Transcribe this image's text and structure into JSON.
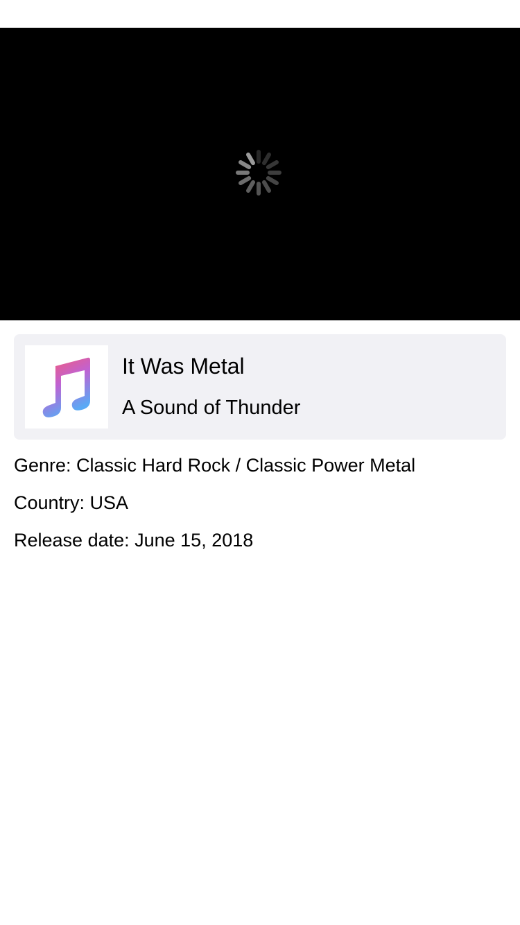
{
  "player": {
    "state": "loading",
    "spinner_icon": "activity-spinner-icon"
  },
  "track": {
    "title": "It Was Metal",
    "artist": "A Sound of Thunder",
    "artwork_icon": "apple-music-note-icon"
  },
  "details": {
    "genre": "Genre: Classic Hard Rock / Classic Power Metal",
    "country": "Country: USA",
    "release_date": "Release date: June 15, 2018"
  },
  "colors": {
    "player_background": "#000000",
    "card_background": "#f1f1f5",
    "spinner": "#8e8e8e",
    "note_gradient_top": "#f65a6f",
    "note_gradient_mid": "#c061d4",
    "note_gradient_bottom": "#5aa9f5"
  }
}
